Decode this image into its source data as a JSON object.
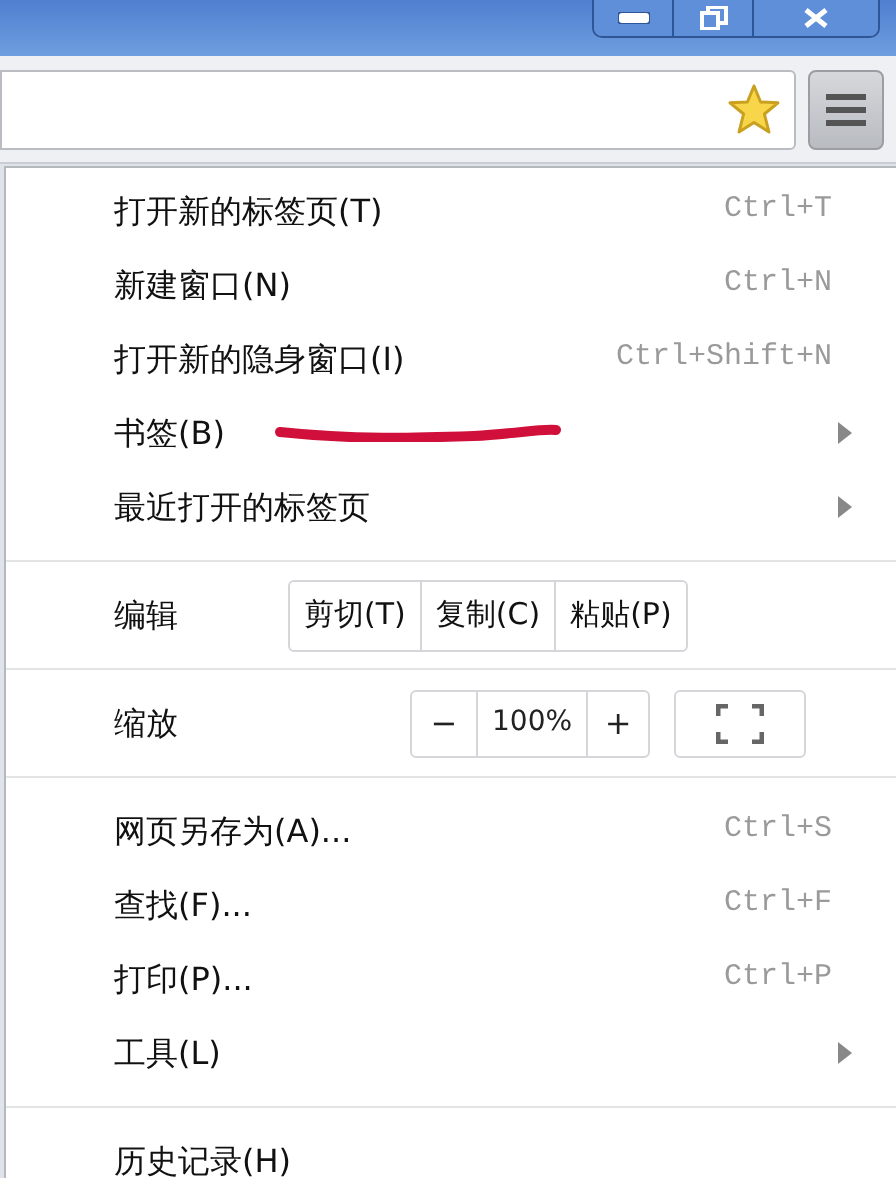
{
  "toolbar": {
    "bookmarked": true
  },
  "menu": {
    "sections": [
      {
        "kind": "commands",
        "items": [
          {
            "label": "打开新的标签页(T)",
            "shortcut": "Ctrl+T",
            "submenu": false
          },
          {
            "label": "新建窗口(N)",
            "shortcut": "Ctrl+N",
            "submenu": false
          },
          {
            "label": "打开新的隐身窗口(I)",
            "shortcut": "Ctrl+Shift+N",
            "submenu": false
          },
          {
            "label": "书签(B)",
            "submenu": true
          },
          {
            "label": "最近打开的标签页",
            "submenu": true
          }
        ]
      },
      {
        "kind": "edit",
        "label": "编辑",
        "buttons": [
          "剪切(T)",
          "复制(C)",
          "粘贴(P)"
        ]
      },
      {
        "kind": "zoom",
        "label": "缩放",
        "minus": "−",
        "value": "100%",
        "plus": "+"
      },
      {
        "kind": "commands",
        "items": [
          {
            "label": "网页另存为(A)...",
            "shortcut": "Ctrl+S",
            "submenu": false
          },
          {
            "label": "查找(F)...",
            "shortcut": "Ctrl+F",
            "submenu": false
          },
          {
            "label": "打印(P)...",
            "shortcut": "Ctrl+P",
            "submenu": false
          },
          {
            "label": "工具(L)",
            "submenu": true
          }
        ]
      },
      {
        "kind": "commands",
        "items": [
          {
            "label": "历史记录(H)",
            "submenu": false
          }
        ]
      }
    ]
  }
}
